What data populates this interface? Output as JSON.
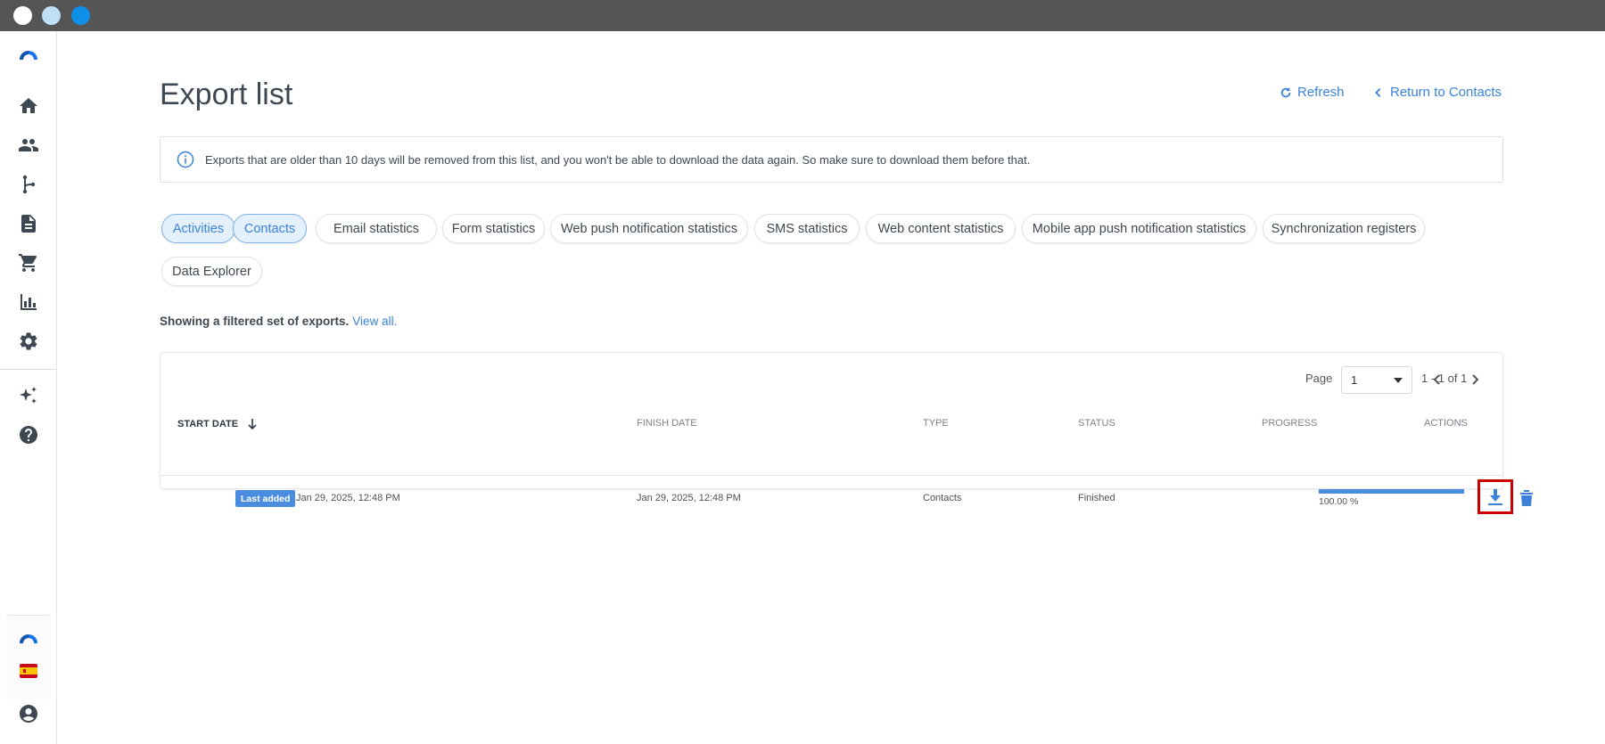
{
  "page": {
    "title": "Export list",
    "refresh_label": "Refresh",
    "return_label": "Return to Contacts"
  },
  "info": {
    "text": "Exports that are older than 10 days will be removed from this list, and you won't be able to download the data again. So make sure to download them before that."
  },
  "filters": [
    {
      "label": "Activities",
      "active": true
    },
    {
      "label": "Contacts",
      "active": true
    },
    {
      "label": "Email statistics",
      "active": false
    },
    {
      "label": "Form statistics",
      "active": false
    },
    {
      "label": "Web push notification statistics",
      "active": false
    },
    {
      "label": "SMS statistics",
      "active": false
    },
    {
      "label": "Web content statistics",
      "active": false
    },
    {
      "label": "Mobile app push notification statistics",
      "active": false
    },
    {
      "label": "Synchronization registers",
      "active": false
    },
    {
      "label": "Data Explorer",
      "active": false
    }
  ],
  "filter_note": {
    "text": "Showing a filtered set of exports.",
    "link": "View all."
  },
  "pager": {
    "label": "Page",
    "value": "1",
    "range": "1 - 1 of 1"
  },
  "table": {
    "headers": {
      "start_date": "START DATE",
      "finish_date": "FINISH DATE",
      "type": "TYPE",
      "status": "STATUS",
      "progress": "PROGRESS",
      "actions": "ACTIONS"
    },
    "rows": [
      {
        "badge": "Last added",
        "start_date": "Jan 29, 2025, 12:48 PM",
        "finish_date": "Jan 29, 2025, 12:48 PM",
        "type": "Contacts",
        "status": "Finished",
        "progress_text": "100.00 %",
        "progress_fraction": 1.0
      }
    ]
  },
  "sidebar": {
    "icons": [
      "logo-icon",
      "home-icon",
      "contacts-icon",
      "automation-icon",
      "content-icon",
      "cart-icon",
      "reports-icon",
      "settings-icon",
      "sparkle-icon",
      "help-icon",
      "logo-icon",
      "spain-flag-icon",
      "user-account-icon"
    ]
  },
  "colors": {
    "accent": "#3b82d8",
    "highlight_box": "#cc0000",
    "titlebar": "#555555"
  }
}
